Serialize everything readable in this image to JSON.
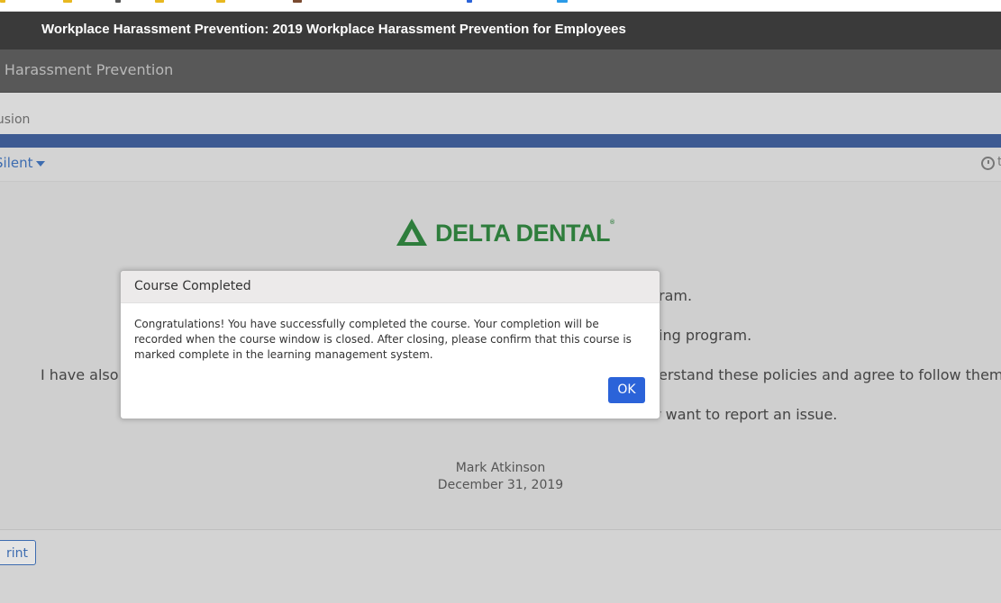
{
  "window": {
    "title": "Workplace Harassment Prevention: 2019 Workplace Harassment Prevention for Employees"
  },
  "course_bar": {
    "label": "e Harassment Prevention"
  },
  "module_bar": {
    "label": "lusion"
  },
  "controls": {
    "audio_label": "Silent",
    "timer_text": "t"
  },
  "content": {
    "logo_text": "DELTA DENTAL",
    "logo_mark": "®",
    "lines": [
      "ram.",
      "ing program.",
      "I have also r",
      "erstand these policies and agree to follow them.",
      "r want to report an issue."
    ],
    "signature_name": "Mark Atkinson",
    "signature_date": "December 31, 2019"
  },
  "footer": {
    "print_label": "rint"
  },
  "dialog": {
    "title": "Course Completed",
    "body": "Congratulations! You have successfully completed the course. Your completion will be recorded when the course window is closed. After closing, please confirm that this course is marked complete in the learning management system.",
    "ok_label": "OK"
  },
  "colors": {
    "accent_blue": "#2b63d9",
    "progress_bar": "#3d5a92",
    "logo_green": "#2e7d3c",
    "title_bar": "#3a3a3a"
  }
}
